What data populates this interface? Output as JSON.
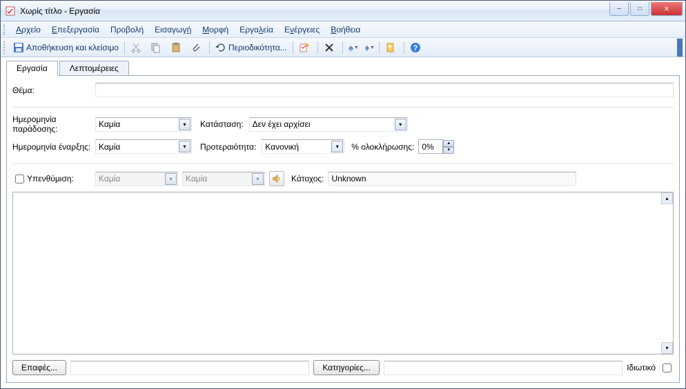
{
  "window": {
    "title": "Χωρίς τίτλο - Εργασία"
  },
  "menu": {
    "file": "Αρχείο",
    "edit": "Επεξεργασία",
    "view": "Προβολή",
    "insert": "Εισαγωγή",
    "format": "Μορφή",
    "tools": "Εργαλεία",
    "actions": "Ενέργειες",
    "help": "Βοήθεια"
  },
  "toolbar": {
    "save_close": "Αποθήκευση και κλείσιμο",
    "recurrence": "Περιοδικότητα..."
  },
  "tabs": {
    "task": "Εργασία",
    "details": "Λεπτομέρειες",
    "active": "task"
  },
  "fields": {
    "subject_label": "Θέμα:",
    "subject_value": "",
    "due_label": "Ημερομηνία παράδοσης:",
    "due_value": "Καμία",
    "start_label": "Ημερομηνία έναρξης:",
    "start_value": "Καμία",
    "status_label": "Κατάσταση:",
    "status_value": "Δεν έχει αρχίσει",
    "priority_label": "Προτεραιότητα:",
    "priority_value": "Κανονική",
    "pct_label": "% ολοκλήρωσης:",
    "pct_value": "0%",
    "reminder_label": "Υπενθύμιση:",
    "reminder_date": "Καμία",
    "reminder_time": "Καμία",
    "owner_label": "Κάτοχος:",
    "owner_value": "Unknown"
  },
  "footer": {
    "contacts": "Επαφές...",
    "contacts_value": "",
    "categories": "Κατηγορίες...",
    "categories_value": "",
    "private": "Ιδιωτικό"
  }
}
